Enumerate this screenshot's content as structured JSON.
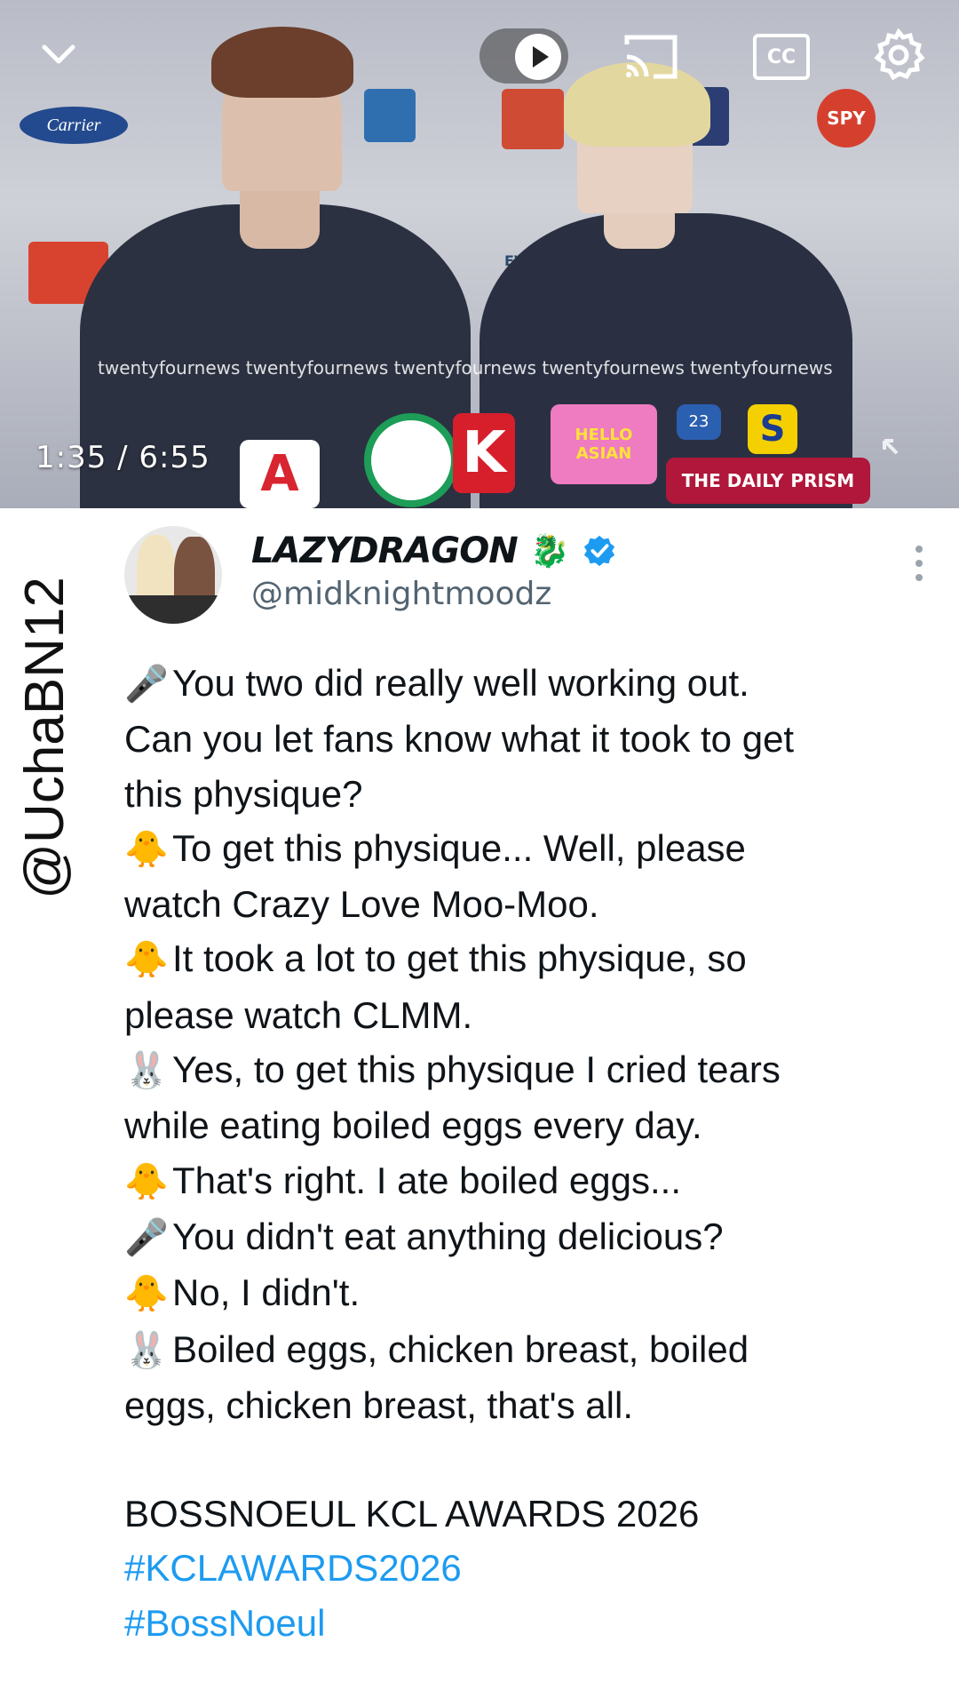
{
  "video": {
    "time_current": "1:35",
    "time_total": "6:55",
    "time_display": "1:35 / 6:55",
    "cc_label": "CC",
    "ticker_text": "twentyfournews twentyfournews twentyfournews twentyfournews twentyfournews",
    "logos": {
      "carrier": "Carrier",
      "spy": "SPY",
      "eva": "EVA",
      "k": "K",
      "a": "A",
      "hello": "HELLO ASIAN",
      "s": "S",
      "daily": "THE DAILY",
      "prism": "PRISM",
      "num": "23"
    }
  },
  "watermark": "@UchaBN12",
  "tweet": {
    "display_name": "LAZYDRAGON",
    "handle": "@midknightmoodz",
    "lines": [
      {
        "icon": "🎤",
        "text": "You two did really well working out."
      },
      {
        "icon": "",
        "text": "Can you let fans know what it took to get"
      },
      {
        "icon": "",
        "text": "this physique?"
      },
      {
        "icon": "🐥",
        "text": "To get this physique... Well, please"
      },
      {
        "icon": "",
        "text": "watch Crazy Love Moo-Moo."
      },
      {
        "icon": "🐥",
        "text": "It took a lot to get this physique, so"
      },
      {
        "icon": "",
        "text": "please watch CLMM."
      },
      {
        "icon": "🐰",
        "text": "Yes, to get this physique I cried tears"
      },
      {
        "icon": "",
        "text": "while eating boiled eggs every day."
      },
      {
        "icon": "🐥",
        "text": "That's right. I ate boiled eggs..."
      },
      {
        "icon": "🎤",
        "text": "You didn't eat anything delicious?"
      },
      {
        "icon": "🐥",
        "text": "No, I didn't."
      },
      {
        "icon": "🐰",
        "text": "Boiled eggs, chicken breast, boiled"
      },
      {
        "icon": "",
        "text": "eggs, chicken breast, that's all."
      }
    ],
    "footer": "BOSSNOEUL KCL AWARDS 2026",
    "hashtags": [
      "#KCLAWARDS2026",
      "#BossNoeul"
    ]
  },
  "colors": {
    "hashtag": "#1d9bf0",
    "verified": "#1d9bf0",
    "handle": "#536471",
    "text": "#0f1419"
  },
  "icons": [
    "chevron-down-icon",
    "play-icon",
    "cast-icon",
    "cc-icon",
    "gear-icon",
    "expand-icon",
    "verified-icon",
    "dragon-icon",
    "more-icon",
    "microphone-icon",
    "chick-icon",
    "rabbit-icon"
  ]
}
